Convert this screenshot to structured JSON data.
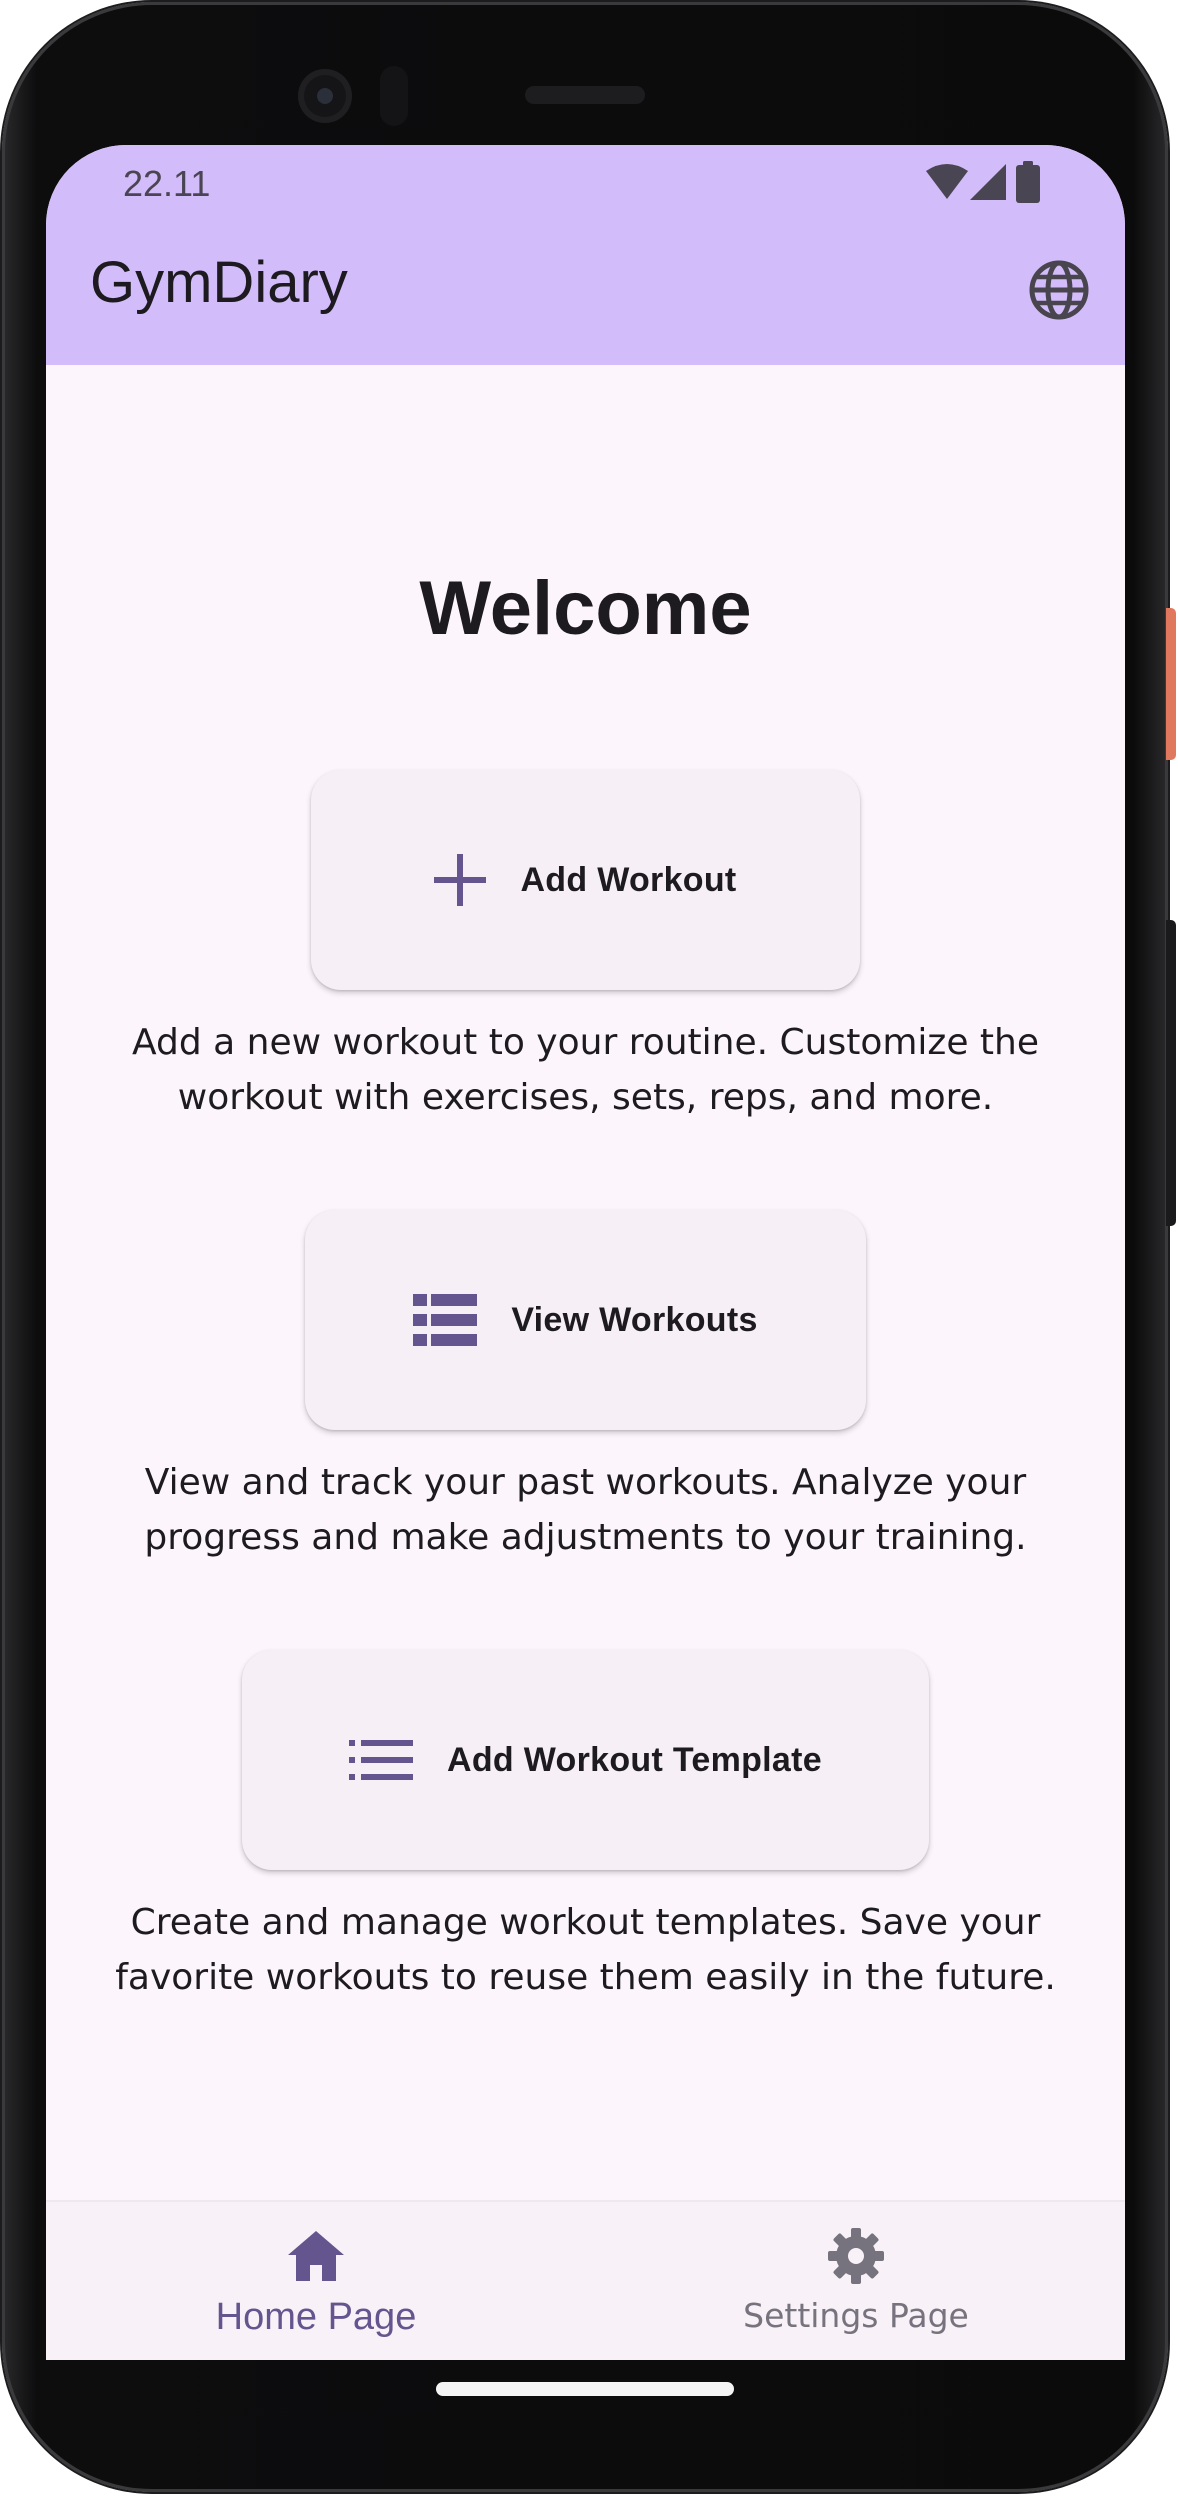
{
  "status_bar": {
    "time": "22.11",
    "icons": [
      "wifi-icon",
      "signal-icon",
      "battery-icon"
    ]
  },
  "app_bar": {
    "title": "GymDiary",
    "action_icon": "globe-icon"
  },
  "main": {
    "heading": "Welcome",
    "actions": [
      {
        "icon": "plus-icon",
        "label": "Add Workout",
        "description": "Add a new workout to your routine. Customize the workout with exercises, sets, reps, and more."
      },
      {
        "icon": "view-list-icon",
        "label": "View Workouts",
        "description": "View and track your past workouts. Analyze your progress and make adjustments to your training."
      },
      {
        "icon": "list-icon",
        "label": "Add Workout Template",
        "description": "Create and manage workout templates. Save your favorite workouts to reuse them easily in the future."
      }
    ]
  },
  "bottom_nav": {
    "items": [
      {
        "icon": "home-icon",
        "label": "Home Page",
        "selected": true
      },
      {
        "icon": "gear-icon",
        "label": "Settings Page",
        "selected": false
      }
    ]
  },
  "colors": {
    "top_bar": "#d3bcfa",
    "background": "#fcf6fc",
    "accent": "#65558f",
    "button_surface": "#f6eff6"
  }
}
